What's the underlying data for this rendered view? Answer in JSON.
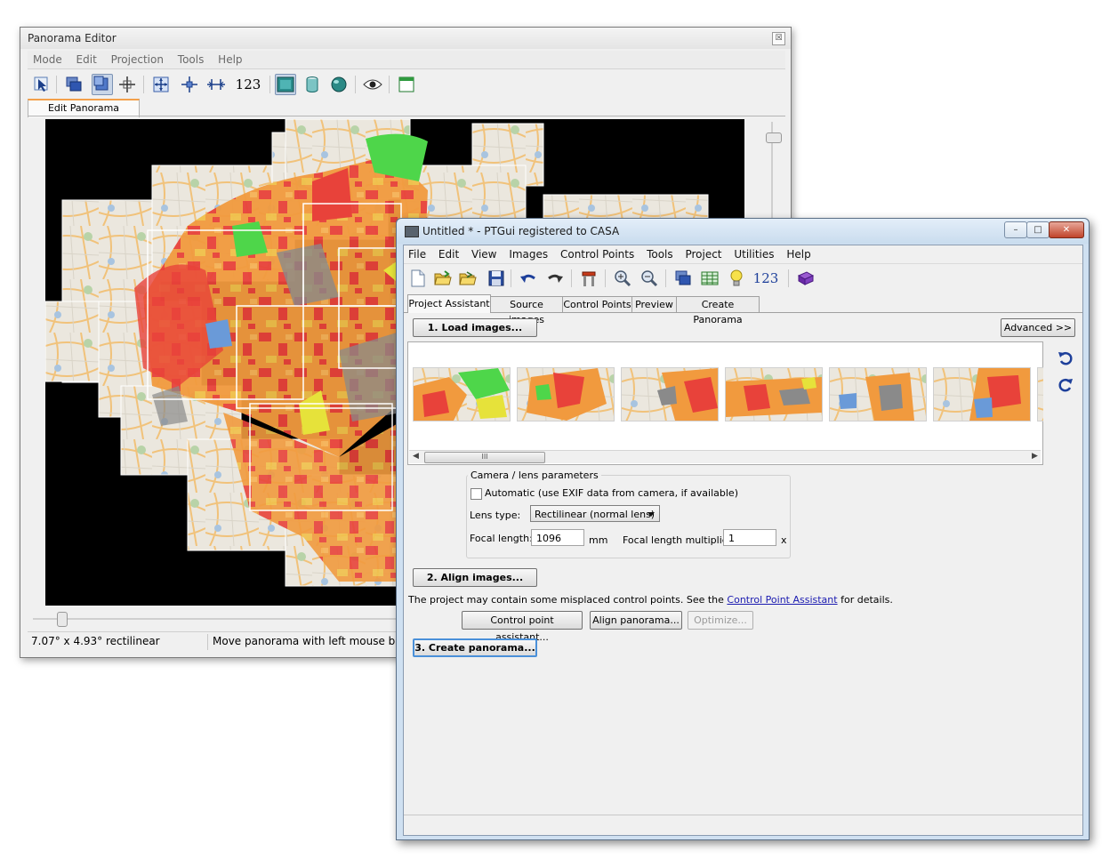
{
  "panorama_editor": {
    "title": "Panorama Editor",
    "close_glyph": "☒",
    "menu": [
      "Mode",
      "Edit",
      "Projection",
      "Tools",
      "Help"
    ],
    "toolbar_number_label": "123",
    "tab_label": "Edit Panorama",
    "status_fov": "7.07° x 4.93° rectilinear",
    "status_hint": "Move panorama with left mouse butto"
  },
  "ptgui": {
    "title": "Untitled * - PTGui registered to CASA",
    "window_buttons": {
      "minimize": "–",
      "maximize": "□",
      "close": "✕"
    },
    "menu": [
      "File",
      "Edit",
      "View",
      "Images",
      "Control Points",
      "Tools",
      "Project",
      "Utilities",
      "Help"
    ],
    "toolbar_number_label": "123",
    "tabs": [
      "Project Assistant",
      "Source images",
      "Control Points",
      "Preview",
      "Create Panorama"
    ],
    "active_tab": "Project Assistant",
    "step1_button": "1. Load images...",
    "advanced_button": "Advanced >>",
    "scrollbar_grip": "III",
    "camera_group_title": "Camera / lens parameters",
    "automatic_label": "Automatic (use EXIF data from camera, if available)",
    "automatic_checked": false,
    "lens_type_label": "Lens type:",
    "lens_type_value": "Rectilinear (normal lens)",
    "focal_length_label": "Focal length:",
    "focal_length_value": "1096",
    "focal_length_unit": "mm",
    "multiplier_label": "Focal length multiplier:",
    "multiplier_value": "1",
    "multiplier_unit": "x",
    "step2_button": "2. Align images...",
    "warning_prefix": "The project may contain some misplaced control points. See the ",
    "warning_link": "Control Point Assistant",
    "warning_suffix": " for details.",
    "cp_assistant_button": "Control point assistant...",
    "align_panorama_button": "Align panorama...",
    "optimize_button": "Optimize...",
    "step3_button": "3. Create panorama..."
  },
  "colors": {
    "map_base": "#e9e5dc",
    "map_orange": "#f19a3e",
    "map_red": "#e8423a",
    "map_green": "#4ed64a",
    "map_yellow": "#e6e23a",
    "map_grey": "#8a8a8a",
    "map_blue": "#6a9ad8",
    "focus_blue": "#4a90d9"
  }
}
